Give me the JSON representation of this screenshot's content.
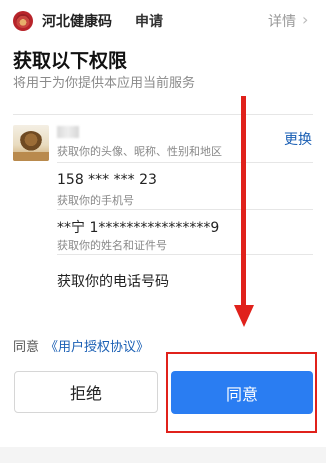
{
  "header": {
    "app_name": "河北健康码",
    "apply": "申请",
    "detail": "详情",
    "chevron": "›"
  },
  "title": "获取以下权限",
  "subtitle": "将用于为你提供本应用当前服务",
  "permissions": {
    "profile_desc": "获取你的头像、昵称、性别和地区",
    "change": "更换",
    "phone_value": "158 *** *** 23",
    "phone_desc": "获取你的手机号",
    "id_value": "**宁 1****************9",
    "id_desc": "获取你的姓名和证件号",
    "tel_item": "获取你的电话号码"
  },
  "agreement": {
    "prefix": "同意",
    "link": "《用户授权协议》"
  },
  "buttons": {
    "reject": "拒绝",
    "agree": "同意"
  },
  "colors": {
    "accent_blue": "#2a7df2",
    "link_blue": "#1a5fb4",
    "annotation_red": "#e0211b"
  }
}
